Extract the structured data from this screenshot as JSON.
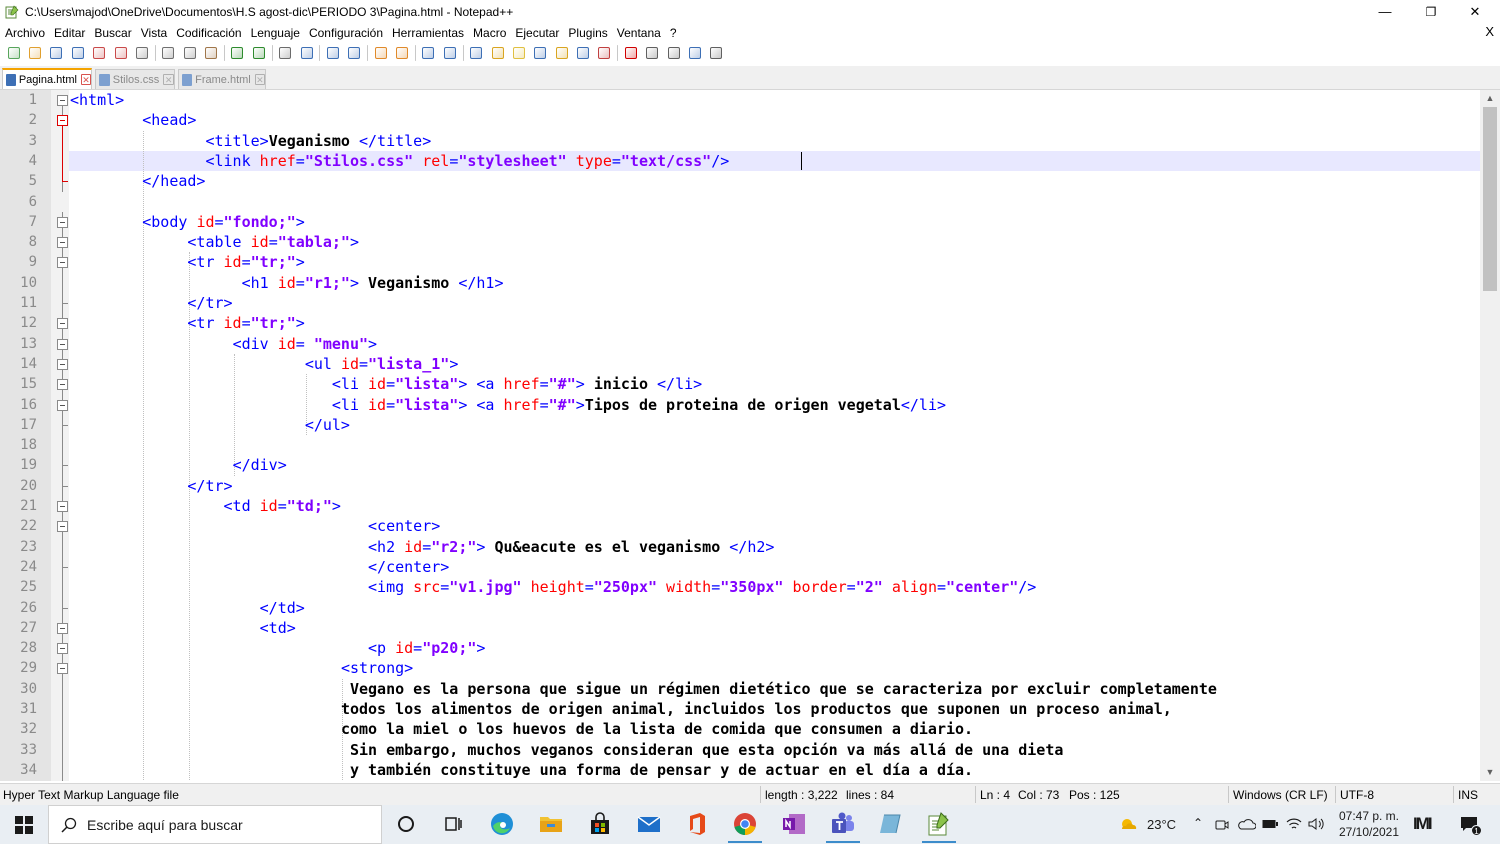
{
  "window": {
    "title": "C:\\Users\\majod\\OneDrive\\Documentos\\H.S agost-dic\\PERIODO 3\\Pagina.html - Notepad++",
    "minimize": "—",
    "maximize": "❐",
    "close": "✕"
  },
  "menu": {
    "items": [
      "Archivo",
      "Editar",
      "Buscar",
      "Vista",
      "Codificación",
      "Lenguaje",
      "Configuración",
      "Herramientas",
      "Macro",
      "Ejecutar",
      "Plugins",
      "Ventana",
      "?"
    ],
    "close_label": "X"
  },
  "toolbar": {
    "icons": [
      "new-file-icon",
      "open-file-icon",
      "save-icon",
      "save-all-icon",
      "close-file-icon",
      "close-all-icon",
      "print-icon",
      "sep",
      "cut-icon",
      "copy-icon",
      "paste-icon",
      "sep",
      "undo-icon",
      "redo-icon",
      "sep",
      "find-icon",
      "replace-icon",
      "sep",
      "zoom-in-icon",
      "zoom-out-icon",
      "sep",
      "sync-vertical-icon",
      "sync-horizontal-icon",
      "sep",
      "word-wrap-icon",
      "show-all-chars-icon",
      "sep",
      "indent-guide-icon",
      "udl-icon",
      "doc-map-icon",
      "function-list-icon",
      "folder-workspace-icon",
      "doc-list-icon",
      "monitoring-icon",
      "sep",
      "record-macro-icon",
      "stop-macro-icon",
      "play-macro-icon",
      "run-macro-multiple-icon",
      "save-macro-icon"
    ],
    "colors": {
      "new-file-icon": "#58a55c",
      "open-file-icon": "#e0a030",
      "save-icon": "#3d6fb5",
      "save-all-icon": "#3d6fb5",
      "close-file-icon": "#c94a4a",
      "close-all-icon": "#c94a4a",
      "print-icon": "#707070",
      "cut-icon": "#707070",
      "copy-icon": "#707070",
      "paste-icon": "#a0764a",
      "undo-icon": "#2e8b2e",
      "redo-icon": "#2e8b2e",
      "find-icon": "#6b6b6b",
      "replace-icon": "#3d6fb5",
      "zoom-in-icon": "#3d6fb5",
      "zoom-out-icon": "#3d6fb5",
      "sync-vertical-icon": "#e08a2a",
      "sync-horizontal-icon": "#e08a2a",
      "word-wrap-icon": "#3d6fb5",
      "show-all-chars-icon": "#3d6fb5",
      "indent-guide-icon": "#3d6fb5",
      "udl-icon": "#d9a520",
      "doc-map-icon": "#e0c040",
      "function-list-icon": "#3d6fb5",
      "folder-workspace-icon": "#d9a520",
      "doc-list-icon": "#3d6fb5",
      "monitoring-icon": "#c04040",
      "record-macro-icon": "#d00000",
      "stop-macro-icon": "#606060",
      "play-macro-icon": "#606060",
      "run-macro-multiple-icon": "#3d6fb5",
      "save-macro-icon": "#606060"
    }
  },
  "tabs": [
    {
      "label": "Pagina.html",
      "active": true,
      "close": "✕"
    },
    {
      "label": "Stilos.css",
      "active": false,
      "close": "✕"
    },
    {
      "label": "Frame.html",
      "active": false,
      "close": "✕"
    }
  ],
  "editor": {
    "current_line": 4,
    "lines": [
      {
        "n": "1",
        "fold": "box",
        "tokens": [
          [
            "t",
            "<html>"
          ]
        ]
      },
      {
        "n": "2",
        "fold": "box-red",
        "tokens": [
          [
            "p",
            "        "
          ],
          [
            "t",
            "<head>"
          ]
        ]
      },
      {
        "n": "3",
        "fold": "line-red",
        "tokens": [
          [
            "p",
            "               "
          ],
          [
            "t",
            "<title>"
          ],
          [
            "x",
            "Veganismo "
          ],
          [
            "t",
            "</title>"
          ]
        ]
      },
      {
        "n": "4",
        "fold": "line-red",
        "tokens": [
          [
            "p",
            "               "
          ],
          [
            "t",
            "<link "
          ],
          [
            "a",
            "href"
          ],
          [
            "t",
            "="
          ],
          [
            "v",
            "\"Stilos.css\""
          ],
          [
            "t",
            " "
          ],
          [
            "a",
            "rel"
          ],
          [
            "t",
            "="
          ],
          [
            "v",
            "\"stylesheet\""
          ],
          [
            "t",
            " "
          ],
          [
            "a",
            "type"
          ],
          [
            "t",
            "="
          ],
          [
            "v",
            "\"text/css\""
          ],
          [
            "t",
            "/>"
          ]
        ]
      },
      {
        "n": "5",
        "fold": "end-red",
        "tokens": [
          [
            "p",
            "        "
          ],
          [
            "t",
            "</head>"
          ]
        ]
      },
      {
        "n": "6",
        "fold": "none",
        "tokens": []
      },
      {
        "n": "7",
        "fold": "box",
        "tokens": [
          [
            "p",
            "        "
          ],
          [
            "t",
            "<body "
          ],
          [
            "a",
            "id"
          ],
          [
            "t",
            "="
          ],
          [
            "v",
            "\"fondo;\""
          ],
          [
            "t",
            ">"
          ]
        ]
      },
      {
        "n": "8",
        "fold": "box",
        "tokens": [
          [
            "p",
            "             "
          ],
          [
            "t",
            "<table "
          ],
          [
            "a",
            "id"
          ],
          [
            "t",
            "="
          ],
          [
            "v",
            "\"tabla;\""
          ],
          [
            "t",
            ">"
          ]
        ]
      },
      {
        "n": "9",
        "fold": "box",
        "tokens": [
          [
            "p",
            "             "
          ],
          [
            "t",
            "<tr "
          ],
          [
            "a",
            "id"
          ],
          [
            "t",
            "="
          ],
          [
            "v",
            "\"tr;\""
          ],
          [
            "t",
            ">"
          ]
        ]
      },
      {
        "n": "10",
        "fold": "line",
        "tokens": [
          [
            "p",
            "                   "
          ],
          [
            "t",
            "<h1 "
          ],
          [
            "a",
            "id"
          ],
          [
            "t",
            "="
          ],
          [
            "v",
            "\"r1;\""
          ],
          [
            "t",
            "> "
          ],
          [
            "x",
            "Veganismo "
          ],
          [
            "t",
            "</h1>"
          ]
        ]
      },
      {
        "n": "11",
        "fold": "end",
        "tokens": [
          [
            "p",
            "             "
          ],
          [
            "t",
            "</tr>"
          ]
        ]
      },
      {
        "n": "12",
        "fold": "box",
        "tokens": [
          [
            "p",
            "             "
          ],
          [
            "t",
            "<tr "
          ],
          [
            "a",
            "id"
          ],
          [
            "t",
            "="
          ],
          [
            "v",
            "\"tr;\""
          ],
          [
            "t",
            ">"
          ]
        ]
      },
      {
        "n": "13",
        "fold": "box",
        "tokens": [
          [
            "p",
            "                  "
          ],
          [
            "t",
            "<div "
          ],
          [
            "a",
            "id"
          ],
          [
            "t",
            "= "
          ],
          [
            "v",
            "\"menu\""
          ],
          [
            "t",
            ">"
          ]
        ]
      },
      {
        "n": "14",
        "fold": "box",
        "tokens": [
          [
            "p",
            "                          "
          ],
          [
            "t",
            "<ul "
          ],
          [
            "a",
            "id"
          ],
          [
            "t",
            "="
          ],
          [
            "v",
            "\"lista_1\""
          ],
          [
            "t",
            ">"
          ]
        ]
      },
      {
        "n": "15",
        "fold": "box",
        "tokens": [
          [
            "p",
            "                             "
          ],
          [
            "t",
            "<li "
          ],
          [
            "a",
            "id"
          ],
          [
            "t",
            "="
          ],
          [
            "v",
            "\"lista\""
          ],
          [
            "t",
            "> <a "
          ],
          [
            "a",
            "href"
          ],
          [
            "t",
            "="
          ],
          [
            "v",
            "\"#\""
          ],
          [
            "t",
            "> "
          ],
          [
            "x",
            "inicio "
          ],
          [
            "t",
            "</li>"
          ]
        ]
      },
      {
        "n": "16",
        "fold": "box",
        "tokens": [
          [
            "p",
            "                             "
          ],
          [
            "t",
            "<li "
          ],
          [
            "a",
            "id"
          ],
          [
            "t",
            "="
          ],
          [
            "v",
            "\"lista\""
          ],
          [
            "t",
            "> <a "
          ],
          [
            "a",
            "href"
          ],
          [
            "t",
            "="
          ],
          [
            "v",
            "\"#\""
          ],
          [
            "t",
            ">"
          ],
          [
            "x",
            "Tipos de proteina de origen vegetal"
          ],
          [
            "t",
            "</li>"
          ]
        ]
      },
      {
        "n": "17",
        "fold": "end",
        "tokens": [
          [
            "p",
            "                          "
          ],
          [
            "t",
            "</ul>"
          ]
        ]
      },
      {
        "n": "18",
        "fold": "line",
        "tokens": []
      },
      {
        "n": "19",
        "fold": "end",
        "tokens": [
          [
            "p",
            "                  "
          ],
          [
            "t",
            "</div>"
          ]
        ]
      },
      {
        "n": "20",
        "fold": "end",
        "tokens": [
          [
            "p",
            "             "
          ],
          [
            "t",
            "</tr>"
          ]
        ]
      },
      {
        "n": "21",
        "fold": "box",
        "tokens": [
          [
            "p",
            "                 "
          ],
          [
            "t",
            "<td "
          ],
          [
            "a",
            "id"
          ],
          [
            "t",
            "="
          ],
          [
            "v",
            "\"td;\""
          ],
          [
            "t",
            ">"
          ]
        ]
      },
      {
        "n": "22",
        "fold": "box",
        "tokens": [
          [
            "p",
            "                                 "
          ],
          [
            "t",
            "<center>"
          ]
        ]
      },
      {
        "n": "23",
        "fold": "line",
        "tokens": [
          [
            "p",
            "                                 "
          ],
          [
            "t",
            "<h2 "
          ],
          [
            "a",
            "id"
          ],
          [
            "t",
            "="
          ],
          [
            "v",
            "\"r2;\""
          ],
          [
            "t",
            "> "
          ],
          [
            "x",
            "Qu&eacute es el veganismo "
          ],
          [
            "t",
            "</h2>"
          ]
        ]
      },
      {
        "n": "24",
        "fold": "end",
        "tokens": [
          [
            "p",
            "                                 "
          ],
          [
            "t",
            "</center>"
          ]
        ]
      },
      {
        "n": "25",
        "fold": "line",
        "tokens": [
          [
            "p",
            "                                 "
          ],
          [
            "t",
            "<img "
          ],
          [
            "a",
            "src"
          ],
          [
            "t",
            "="
          ],
          [
            "v",
            "\"v1.jpg\""
          ],
          [
            "t",
            " "
          ],
          [
            "a",
            "height"
          ],
          [
            "t",
            "="
          ],
          [
            "v",
            "\"250px\""
          ],
          [
            "t",
            " "
          ],
          [
            "a",
            "width"
          ],
          [
            "t",
            "="
          ],
          [
            "v",
            "\"350px\""
          ],
          [
            "t",
            " "
          ],
          [
            "a",
            "border"
          ],
          [
            "t",
            "="
          ],
          [
            "v",
            "\"2\""
          ],
          [
            "t",
            " "
          ],
          [
            "a",
            "align"
          ],
          [
            "t",
            "="
          ],
          [
            "v",
            "\"center\""
          ],
          [
            "t",
            "/>"
          ]
        ]
      },
      {
        "n": "26",
        "fold": "end",
        "tokens": [
          [
            "p",
            "                     "
          ],
          [
            "t",
            "</td>"
          ]
        ]
      },
      {
        "n": "27",
        "fold": "box",
        "tokens": [
          [
            "p",
            "                     "
          ],
          [
            "t",
            "<td>"
          ]
        ]
      },
      {
        "n": "28",
        "fold": "box",
        "tokens": [
          [
            "p",
            "                                 "
          ],
          [
            "t",
            "<p "
          ],
          [
            "a",
            "id"
          ],
          [
            "t",
            "="
          ],
          [
            "v",
            "\"p20;\""
          ],
          [
            "t",
            ">"
          ]
        ]
      },
      {
        "n": "29",
        "fold": "box",
        "tokens": [
          [
            "p",
            "                              "
          ],
          [
            "t",
            "<strong>"
          ]
        ]
      },
      {
        "n": "30",
        "fold": "line",
        "tokens": [
          [
            "p",
            "                               "
          ],
          [
            "x",
            "Vegano es la persona que sigue un régimen dietético que se caracteriza por excluir completamente"
          ]
        ]
      },
      {
        "n": "31",
        "fold": "line",
        "tokens": [
          [
            "p",
            "                              "
          ],
          [
            "x",
            "todos los alimentos de origen animal, incluidos los productos que suponen un proceso animal,"
          ]
        ]
      },
      {
        "n": "32",
        "fold": "line",
        "tokens": [
          [
            "p",
            "                              "
          ],
          [
            "x",
            "como la miel o los huevos de la lista de comida que consumen a diario."
          ]
        ]
      },
      {
        "n": "33",
        "fold": "line",
        "tokens": [
          [
            "p",
            "                               "
          ],
          [
            "x",
            "Sin embargo, muchos veganos consideran que esta opción va más allá de una dieta"
          ]
        ]
      },
      {
        "n": "34",
        "fold": "line",
        "tokens": [
          [
            "p",
            "                               "
          ],
          [
            "x",
            "y también constituye una forma de pensar y de actuar en el día a día."
          ]
        ]
      }
    ]
  },
  "statusbar": {
    "filetype": "Hyper Text Markup Language file",
    "length": "length : 3,222",
    "lines": "lines : 84",
    "ln": "Ln : 4",
    "col": "Col : 73",
    "pos": "Pos : 125",
    "eol": "Windows (CR LF)",
    "encoding": "UTF-8",
    "mode": "INS"
  },
  "taskbar": {
    "search_placeholder": "Escribe aquí para buscar",
    "apps": [
      "cortana-icon",
      "task-view-icon",
      "edge-icon",
      "file-explorer-icon",
      "store-icon",
      "mail-icon",
      "office-icon",
      "chrome-icon",
      "onenote-icon",
      "teams-icon",
      "tablet-icon",
      "notepadpp-icon"
    ],
    "temperature": "23°C",
    "time": "07:47 p. m.",
    "date": "27/10/2021",
    "notification_count": "1"
  }
}
